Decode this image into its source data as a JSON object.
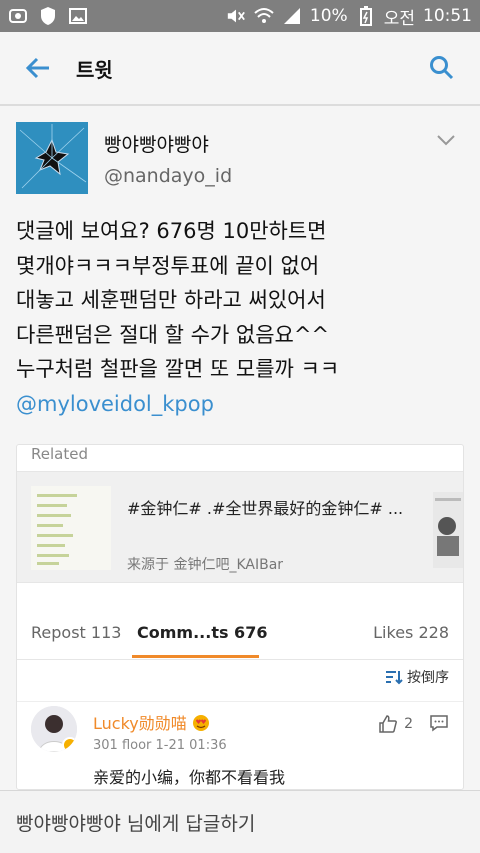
{
  "status_bar": {
    "battery": "10%",
    "ampm": "오전",
    "time": "10:51",
    "left_icons": [
      "app-icon",
      "shield-icon",
      "image-icon"
    ],
    "right_icons": [
      "mute-icon",
      "wifi-icon",
      "signal-icon",
      "battery-icon"
    ]
  },
  "app_bar": {
    "title": "트윗",
    "accent_color": "#3a8fcf"
  },
  "tweet": {
    "author_name": "빵야빵야빵야",
    "author_handle": "@nandayo_id",
    "lines": [
      "댓글에 보여요? 676명 10만하트면",
      "몇개야ㅋㅋㅋ부정투표에 끝이 없어",
      "대놓고 세훈팬덤만 하라고 써있어서",
      "다른팬덤은 절대 할 수가 없음요^^",
      "누구처럼 철판을 깔면 또 모를까 ㅋㅋ"
    ],
    "mention": "@myloveidol_kpop"
  },
  "card": {
    "related_label": "Related",
    "related_title": "#金钟仁# .#全世界最好的金钟仁# ...",
    "related_source": "来源于 金钟仁吧_KAIBar",
    "tabs": {
      "repost": "Repost 113",
      "comments": "Comm...ts 676",
      "likes": "Likes 228"
    },
    "sort_label": "按倒序",
    "comment": {
      "name": "Lucky勋勋喵",
      "meta": "301 floor 1-21 01:36",
      "text": "亲爱的小编，你都不看看我",
      "likes": "2"
    }
  },
  "reply_bar": {
    "placeholder": "빵야빵야빵야 님에게 답글하기"
  },
  "colors": {
    "status_bar": "#7f7f7f",
    "accent": "#3a8fcf",
    "orange": "#f08a2a"
  }
}
